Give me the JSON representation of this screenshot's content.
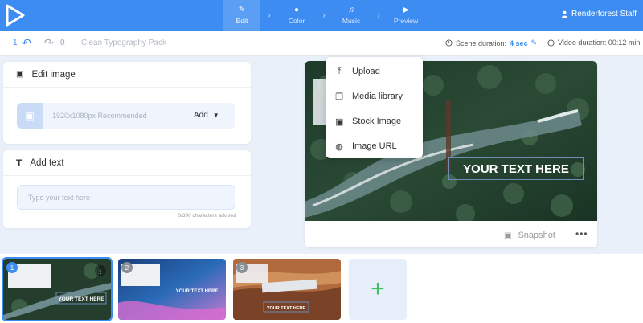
{
  "topbar": {
    "steps": [
      {
        "label": "Edit",
        "icon": "pencil-icon"
      },
      {
        "label": "Color",
        "icon": "palette-icon"
      },
      {
        "label": "Music",
        "icon": "music-note-icon"
      },
      {
        "label": "Preview",
        "icon": "play-icon"
      }
    ],
    "user_name": "Renderforest Staff"
  },
  "toolbar": {
    "undo_count": "1",
    "redo_count": "0",
    "pack_name": "Clean Typography Pack",
    "scene_duration_label": "Scene duration:",
    "scene_duration_value": "4 sec",
    "video_duration": "Video duration: 00:12 min"
  },
  "edit_image": {
    "title": "Edit image",
    "recommended": "1920x1080px Recommended",
    "add_label": "Add"
  },
  "add_text": {
    "title": "Add text",
    "placeholder": "Type your text here",
    "char_count": "0/390 characters advised"
  },
  "dropdown": {
    "items": [
      "Upload",
      "Media library",
      "Stock Image",
      "Image URL"
    ]
  },
  "preview": {
    "overlay_text": "YOUR TEXT HERE",
    "snapshot_label": "Snapshot",
    "more": "•••"
  },
  "scenes": [
    {
      "number": "1"
    },
    {
      "number": "2"
    },
    {
      "number": "3"
    }
  ],
  "colors": {
    "accent": "#3d8cf2",
    "add_scene_plus": "#3fc15f"
  }
}
